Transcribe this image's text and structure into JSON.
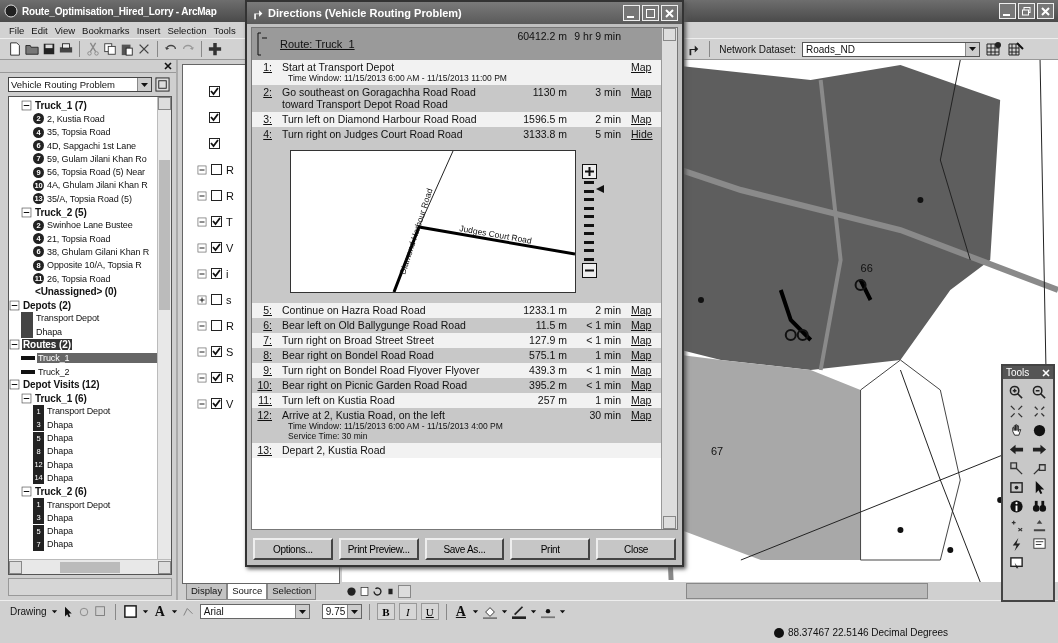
{
  "window": {
    "title": "Route_Optimisation_Hired_Lorry - ArcMap"
  },
  "menu": [
    "File",
    "Edit",
    "View",
    "Bookmarks",
    "Insert",
    "Selection",
    "Tools"
  ],
  "network_toolbar": {
    "label": "Network Dataset:",
    "value": "Roads_ND"
  },
  "analysis_window": {
    "problem": "Vehicle Routing Problem",
    "scrolled_items": [
      {
        "label": "Truck_1 (7)",
        "expanded": true,
        "selected": false,
        "children": [
          {
            "kind": "stop",
            "badge": "2",
            "label": "2, Kustia Road",
            "selected": false
          },
          {
            "kind": "stop",
            "badge": "4",
            "label": "35, Topsia Road",
            "selected": false
          },
          {
            "kind": "stop",
            "badge": "6",
            "label": "4D, Sapgachi 1st Lane",
            "selected": false
          },
          {
            "kind": "stop",
            "badge": "7",
            "label": "59, Gulam Jilani Khan Ro",
            "selected": false
          },
          {
            "kind": "stop",
            "badge": "9",
            "label": "56, Topsia Road (5) Near",
            "selected": false
          },
          {
            "kind": "stop",
            "badge": "10",
            "label": "4A, Ghulam Jilani Khan R",
            "selected": false
          },
          {
            "kind": "stop",
            "badge": "13",
            "label": "35/A, Topsia Road (5)",
            "selected": false
          }
        ]
      },
      {
        "label": "Truck_2 (5)",
        "expanded": true,
        "selected": false,
        "children": [
          {
            "kind": "stop",
            "badge": "2",
            "label": "Swinhoe Lane Bustee",
            "selected": false
          },
          {
            "kind": "stop",
            "badge": "4",
            "label": "21, Topsia Road",
            "selected": false
          },
          {
            "kind": "stop",
            "badge": "6",
            "label": "38, Ghulam Gilani Khan R",
            "selected": false
          },
          {
            "kind": "stop",
            "badge": "8",
            "label": "Opposite 10/A, Topsia R",
            "selected": false
          },
          {
            "kind": "stop",
            "badge": "11",
            "label": "26, Topsia Road",
            "selected": false
          }
        ]
      },
      {
        "label": "<Unassigned> (0)",
        "selected": false
      }
    ],
    "groups": [
      {
        "label": "Depots (2)",
        "expanded": true,
        "selected": false,
        "children": [
          {
            "kind": "depot",
            "label": "Transport Depot",
            "selected": false
          },
          {
            "kind": "depot",
            "label": "Dhapa",
            "selected": false
          }
        ]
      },
      {
        "label": "Routes (2)",
        "expanded": true,
        "selected": true,
        "children": [
          {
            "kind": "route",
            "label": "Truck_1",
            "selected": true
          },
          {
            "kind": "route",
            "label": "Truck_2",
            "selected": false
          }
        ]
      },
      {
        "label": "Depot Visits (12)",
        "expanded": true,
        "selected": false,
        "children": [
          {
            "label": "Truck_1 (6)",
            "expanded": true,
            "selected": false,
            "children": [
              {
                "kind": "visit",
                "badge": "1",
                "label": "Transport Depot",
                "selected": false
              },
              {
                "kind": "visit",
                "badge": "3",
                "label": "Dhapa",
                "selected": false
              },
              {
                "kind": "visit",
                "badge": "5",
                "label": "Dhapa",
                "selected": false
              },
              {
                "kind": "visit",
                "badge": "8",
                "label": "Dhapa",
                "selected": false
              },
              {
                "kind": "visit",
                "badge": "12",
                "label": "Dhapa",
                "selected": false
              },
              {
                "kind": "visit",
                "badge": "14",
                "label": "Dhapa",
                "selected": false
              }
            ]
          },
          {
            "label": "Truck_2 (6)",
            "expanded": true,
            "selected": false,
            "children": [
              {
                "kind": "visit",
                "badge": "1",
                "label": "Transport Depot",
                "selected": false
              },
              {
                "kind": "visit",
                "badge": "3",
                "label": "Dhapa",
                "selected": false
              },
              {
                "kind": "visit",
                "badge": "5",
                "label": "Dhapa",
                "selected": false
              },
              {
                "kind": "visit",
                "badge": "7",
                "label": "Dhapa",
                "selected": false
              }
            ]
          }
        ]
      }
    ]
  },
  "toc": {
    "layers": [
      {
        "kind": "sub",
        "checked": true
      },
      {
        "kind": "sub",
        "checked": true
      },
      {
        "kind": "sub",
        "checked": true
      },
      {
        "kind": "layer",
        "expanded": true,
        "checked": false,
        "label": "R"
      },
      {
        "kind": "layer",
        "expanded": true,
        "checked": false,
        "label": "R"
      },
      {
        "kind": "layer",
        "expanded": true,
        "checked": true,
        "label": "T"
      },
      {
        "kind": "layer",
        "expanded": true,
        "checked": true,
        "label": "V"
      },
      {
        "kind": "layer",
        "expanded": true,
        "checked": true,
        "label": "i"
      },
      {
        "kind": "layer",
        "expanded": false,
        "checked": false,
        "label": "s"
      },
      {
        "kind": "layer",
        "expanded": true,
        "checked": false,
        "label": "R"
      },
      {
        "kind": "layer",
        "expanded": true,
        "checked": true,
        "label": "S"
      },
      {
        "kind": "layer",
        "expanded": true,
        "checked": true,
        "label": "R"
      },
      {
        "kind": "layer",
        "expanded": true,
        "checked": true,
        "label": "V"
      }
    ],
    "tabs": [
      {
        "label": "Display",
        "selected": false
      },
      {
        "label": "Source",
        "selected": true
      },
      {
        "label": "Selection",
        "selected": false
      }
    ]
  },
  "map": {
    "labels": [
      "66",
      "67"
    ]
  },
  "directions": {
    "title": "Directions (Vehicle Routing Problem)",
    "route": {
      "name": "Route: Truck_1",
      "distance": "60412.2 m",
      "time": "9 hr 9 min"
    },
    "steps": [
      {
        "num": "1:",
        "text": "Start at Transport Depot",
        "notes": [
          "Time Window: 11/15/2013 6:00 AM - 11/15/2013 11:00 PM"
        ],
        "link": "Map"
      },
      {
        "num": "2:",
        "text": "Go southeast on Goragachha Road Road toward Transport Depot Road Road",
        "distance": "1130 m",
        "time": "3 min",
        "link": "Map"
      },
      {
        "num": "3:",
        "text": "Turn left on Diamond Harbour Road Road",
        "distance": "1596.5 m",
        "time": "2 min",
        "link": "Map"
      },
      {
        "num": "4:",
        "text": "Turn right on Judges Court Road Road",
        "distance": "3133.8 m",
        "time": "5 min",
        "link": "Hide",
        "map": {
          "labels": [
            "Diamond Harbour Road",
            "Judges Court Road"
          ],
          "zoom": {
            "level": 0.95
          }
        }
      },
      {
        "num": "5:",
        "text": "Continue on Hazra Road Road",
        "distance": "1233.1 m",
        "time": "2 min",
        "link": "Map"
      },
      {
        "num": "6:",
        "text": "Bear left on Old Ballygunge Road Road",
        "distance": "11.5 m",
        "time": "< 1 min",
        "link": "Map"
      },
      {
        "num": "7:",
        "text": "Turn right on Broad Street Street",
        "distance": "127.9 m",
        "time": "< 1 min",
        "link": "Map"
      },
      {
        "num": "8:",
        "text": "Bear right on Bondel Road Road",
        "distance": "575.1 m",
        "time": "1 min",
        "link": "Map"
      },
      {
        "num": "9:",
        "text": "Turn right on Bondel Road Flyover Flyover",
        "distance": "439.3 m",
        "time": "< 1 min",
        "link": "Map"
      },
      {
        "num": "10:",
        "text": "Bear right on Picnic Garden Road Road",
        "distance": "395.2 m",
        "time": "< 1 min",
        "link": "Map"
      },
      {
        "num": "11:",
        "text": "Turn left on Kustia Road",
        "distance": "257 m",
        "time": "1 min",
        "link": "Map"
      },
      {
        "num": "12:",
        "text": "Arrive at 2, Kustia Road, on the left",
        "notes": [
          "Time Window: 11/15/2013 6:00 AM - 11/15/2013 4:00 PM",
          "Service Time: 30 min"
        ],
        "time": "30 min",
        "link": "Map"
      },
      {
        "num": "13:",
        "text": "Depart 2, Kustia Road"
      }
    ],
    "buttons": [
      "Options...",
      "Print Preview...",
      "Save As...",
      "Print",
      "Close"
    ]
  },
  "drawing_toolbar": {
    "menu": "Drawing",
    "text_tool": "A",
    "font": "Arial",
    "size": "9.75",
    "styles": [
      "B",
      "I",
      "U"
    ],
    "font_color": "A"
  },
  "tools_palette": {
    "title": "Tools"
  },
  "status_bar": {
    "coordinates": "88.37467  22.5146 Decimal Degrees"
  }
}
